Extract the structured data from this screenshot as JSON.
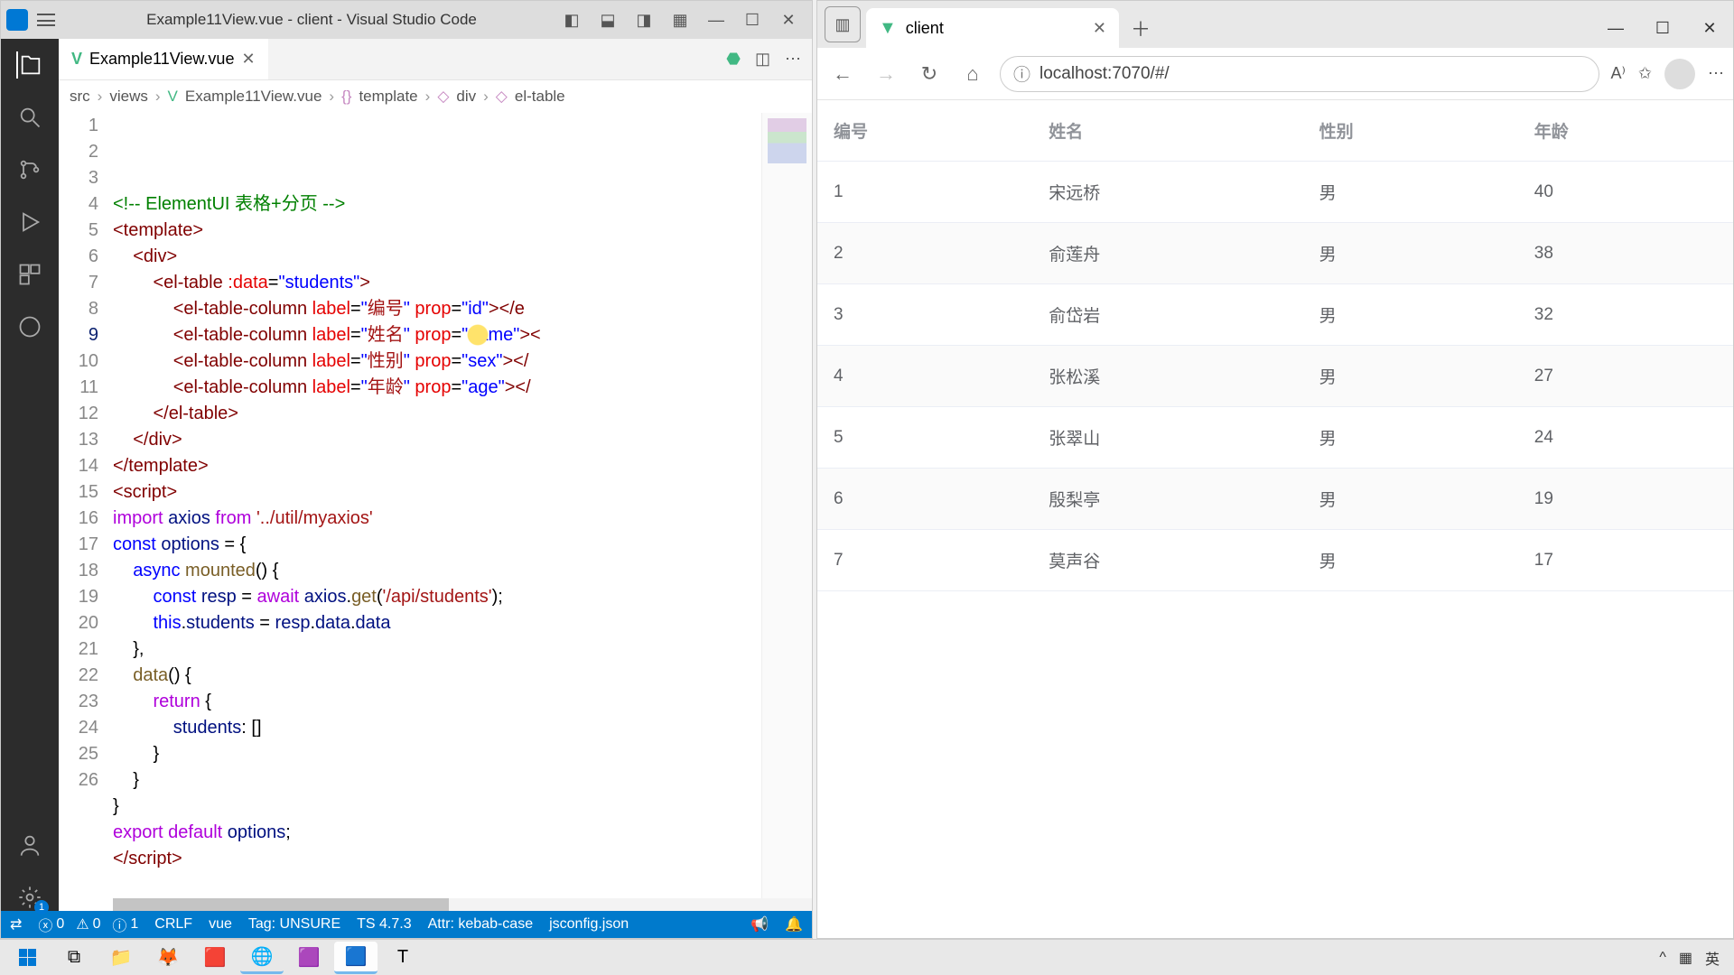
{
  "vscode": {
    "title": "Example11View.vue - client - Visual Studio Code",
    "tab": {
      "name": "Example11View.vue"
    },
    "breadcrumb": [
      "src",
      "views",
      "Example11View.vue",
      "template",
      "div",
      "el-table"
    ],
    "statusbar": {
      "errors": "0",
      "warnings": "0",
      "info": "1",
      "eol": "CRLF",
      "lang": "vue",
      "tag": "Tag: UNSURE",
      "ts": "TS 4.7.3",
      "attr": "Attr: kebab-case",
      "jsconfig": "jsconfig.json"
    },
    "code": [
      {
        "n": 1,
        "html": "<span class='tk-cmt'>&lt;!-- ElementUI 表格+分页 --&gt;</span>"
      },
      {
        "n": 2,
        "html": "<span class='tk-tag'>&lt;template&gt;</span>"
      },
      {
        "n": 3,
        "html": "    <span class='tk-tag'>&lt;div&gt;</span>"
      },
      {
        "n": 4,
        "html": "        <span class='tk-tag'>&lt;el-table</span> <span class='tk-attr'>:data</span>=<span class='tk-str'>\"students\"</span><span class='tk-tag'>&gt;</span>"
      },
      {
        "n": 5,
        "html": "            <span class='tk-tag'>&lt;el-table-column</span> <span class='tk-attr'>label</span>=<span class='tk-str'>\"</span><span class='tk-cn'>编号</span><span class='tk-str'>\"</span> <span class='tk-attr'>prop</span>=<span class='tk-str'>\"id\"</span><span class='tk-tag'>&gt;&lt;/e</span>"
      },
      {
        "n": 6,
        "html": "            <span class='tk-tag'>&lt;el-table-column</span> <span class='tk-attr'>label</span>=<span class='tk-str'>\"</span><span class='tk-cn'>姓名</span><span class='tk-str'>\"</span> <span class='tk-attr'>prop</span>=<span class='tk-str'>\"name\"</span><span class='tk-tag'>&gt;&lt;</span>"
      },
      {
        "n": 7,
        "html": "            <span class='tk-tag'>&lt;el-table-column</span> <span class='tk-attr'>label</span>=<span class='tk-str'>\"</span><span class='tk-cn'>性别</span><span class='tk-str'>\"</span> <span class='tk-attr'>prop</span>=<span class='tk-str'>\"sex\"</span><span class='tk-tag'>&gt;&lt;/</span>"
      },
      {
        "n": 8,
        "html": "            <span class='tk-tag'>&lt;el-table-column</span> <span class='tk-attr'>label</span>=<span class='tk-str'>\"</span><span class='tk-cn'>年龄</span><span class='tk-str'>\"</span> <span class='tk-attr'>prop</span>=<span class='tk-str'>\"age\"</span><span class='tk-tag'>&gt;&lt;/</span>"
      },
      {
        "n": 9,
        "html": "        <span class='tk-tag'>&lt;/el-table&gt;</span>",
        "current": true
      },
      {
        "n": 10,
        "html": "    <span class='tk-tag'>&lt;/div&gt;</span>"
      },
      {
        "n": 11,
        "html": "<span class='tk-tag'>&lt;/template&gt;</span>"
      },
      {
        "n": 12,
        "html": "<span class='tk-tag'>&lt;script&gt;</span>"
      },
      {
        "n": 13,
        "html": "<span class='tk-kw2'>import</span> <span class='tk-var'>axios</span> <span class='tk-kw2'>from</span> <span class='tk-str2'>'../util/myaxios'</span>"
      },
      {
        "n": 14,
        "html": "<span class='tk-kw'>const</span> <span class='tk-var'>options</span> = {"
      },
      {
        "n": 15,
        "html": "    <span class='tk-kw'>async</span> <span class='tk-func'>mounted</span>() {"
      },
      {
        "n": 16,
        "html": "        <span class='tk-kw'>const</span> <span class='tk-var'>resp</span> = <span class='tk-kw2'>await</span> <span class='tk-var'>axios</span>.<span class='tk-func'>get</span>(<span class='tk-str2'>'/api/students'</span>);"
      },
      {
        "n": 17,
        "html": "        <span class='tk-kw'>this</span>.<span class='tk-var'>students</span> = <span class='tk-var'>resp</span>.<span class='tk-var'>data</span>.<span class='tk-var'>data</span>"
      },
      {
        "n": 18,
        "html": "    },"
      },
      {
        "n": 19,
        "html": "    <span class='tk-func'>data</span>() {"
      },
      {
        "n": 20,
        "html": "        <span class='tk-kw2'>return</span> {"
      },
      {
        "n": 21,
        "html": "            <span class='tk-var'>students</span>: []"
      },
      {
        "n": 22,
        "html": "        }"
      },
      {
        "n": 23,
        "html": "    }"
      },
      {
        "n": 24,
        "html": "}"
      },
      {
        "n": 25,
        "html": "<span class='tk-kw2'>export</span> <span class='tk-kw2'>default</span> <span class='tk-var'>options</span>;"
      },
      {
        "n": 26,
        "html": "<span class='tk-tag'>&lt;/script&gt;</span>"
      }
    ]
  },
  "browser": {
    "tab_title": "client",
    "url": "localhost:7070/#/",
    "table": {
      "headers": [
        "编号",
        "姓名",
        "性别",
        "年龄"
      ],
      "rows": [
        [
          "1",
          "宋远桥",
          "男",
          "40"
        ],
        [
          "2",
          "俞莲舟",
          "男",
          "38"
        ],
        [
          "3",
          "俞岱岩",
          "男",
          "32"
        ],
        [
          "4",
          "张松溪",
          "男",
          "27"
        ],
        [
          "5",
          "张翠山",
          "男",
          "24"
        ],
        [
          "6",
          "殷梨亭",
          "男",
          "19"
        ],
        [
          "7",
          "莫声谷",
          "男",
          "17"
        ]
      ]
    }
  },
  "taskbar": {
    "ime": "英",
    "tray_up": "^"
  }
}
